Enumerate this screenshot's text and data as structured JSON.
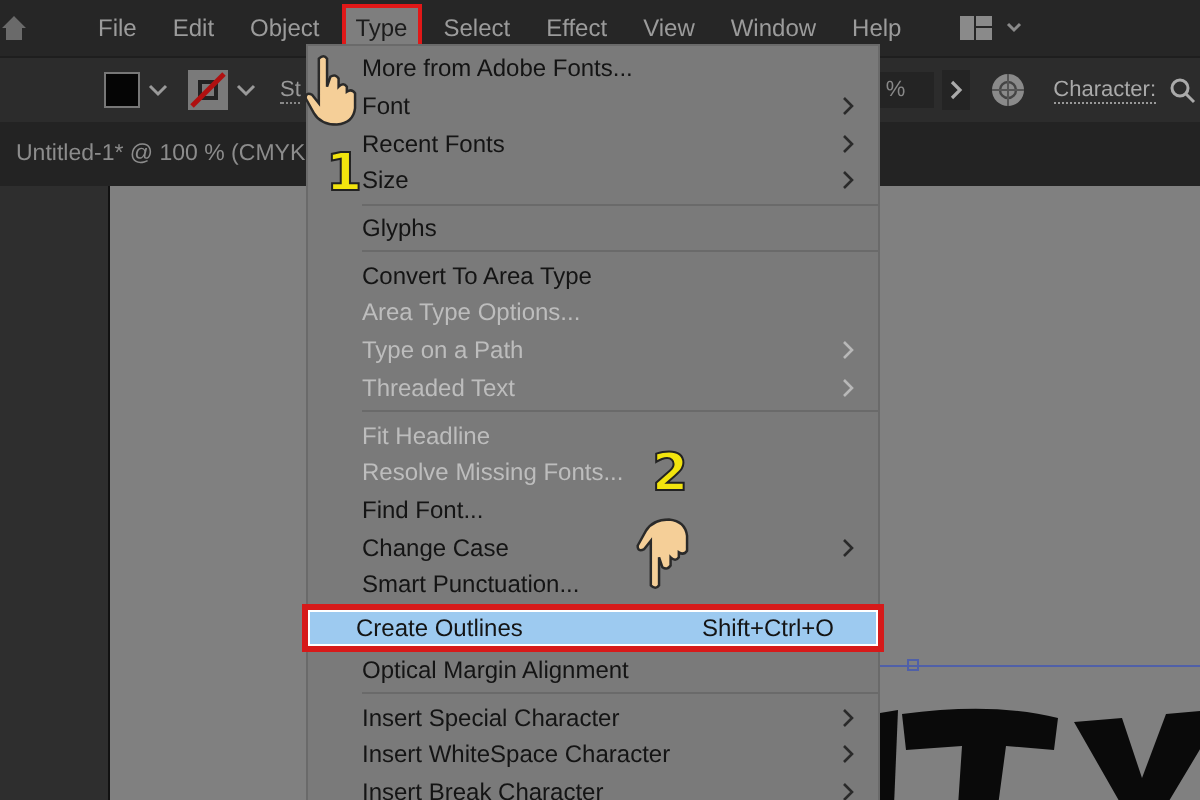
{
  "menubar": {
    "items": [
      {
        "label": "File",
        "selected": false
      },
      {
        "label": "Edit",
        "selected": false
      },
      {
        "label": "Object",
        "selected": false
      },
      {
        "label": "Type",
        "selected": true
      },
      {
        "label": "Select",
        "selected": false
      },
      {
        "label": "Effect",
        "selected": false
      },
      {
        "label": "View",
        "selected": false
      },
      {
        "label": "Window",
        "selected": false
      },
      {
        "label": "Help",
        "selected": false
      }
    ]
  },
  "control_bar": {
    "stroke_label": "St",
    "zoom_fragment": "%",
    "character_label": "Character:"
  },
  "document_tab": {
    "title": "Untitled-1* @ 100 % (CMYK"
  },
  "menu": {
    "items": [
      {
        "kind": "item",
        "label": "More from Adobe Fonts...",
        "disabled": false,
        "selected": false,
        "submenu": false
      },
      {
        "kind": "item",
        "label": "Font",
        "disabled": false,
        "selected": false,
        "submenu": true
      },
      {
        "kind": "item",
        "label": "Recent Fonts",
        "disabled": false,
        "selected": false,
        "submenu": true
      },
      {
        "kind": "item",
        "label": "Size",
        "disabled": false,
        "selected": false,
        "submenu": true
      },
      {
        "kind": "separator"
      },
      {
        "kind": "item",
        "label": "Glyphs",
        "disabled": false,
        "selected": false,
        "submenu": false
      },
      {
        "kind": "separator"
      },
      {
        "kind": "item",
        "label": "Convert To Area Type",
        "disabled": false,
        "selected": false,
        "submenu": false
      },
      {
        "kind": "item",
        "label": "Area Type Options...",
        "disabled": true,
        "selected": false,
        "submenu": false
      },
      {
        "kind": "item",
        "label": "Type on a Path",
        "disabled": true,
        "selected": false,
        "submenu": true
      },
      {
        "kind": "item",
        "label": "Threaded Text",
        "disabled": true,
        "selected": false,
        "submenu": true
      },
      {
        "kind": "separator"
      },
      {
        "kind": "item",
        "label": "Fit Headline",
        "disabled": true,
        "selected": false,
        "submenu": false
      },
      {
        "kind": "item",
        "label": "Resolve Missing Fonts...",
        "disabled": true,
        "selected": false,
        "submenu": false
      },
      {
        "kind": "item",
        "label": "Find Font...",
        "disabled": false,
        "selected": false,
        "submenu": false
      },
      {
        "kind": "item",
        "label": "Change Case",
        "disabled": false,
        "selected": false,
        "submenu": true
      },
      {
        "kind": "item",
        "label": "Smart Punctuation...",
        "disabled": false,
        "selected": false,
        "submenu": false
      },
      {
        "kind": "item",
        "label": "Create Outlines",
        "shortcut": "Shift+Ctrl+O",
        "disabled": false,
        "selected": true,
        "submenu": false
      },
      {
        "kind": "item",
        "label": "Optical Margin Alignment",
        "disabled": false,
        "selected": false,
        "submenu": false
      },
      {
        "kind": "separator"
      },
      {
        "kind": "item",
        "label": "Insert Special Character",
        "disabled": false,
        "selected": false,
        "submenu": true
      },
      {
        "kind": "item",
        "label": "Insert WhiteSpace Character",
        "disabled": false,
        "selected": false,
        "submenu": true
      },
      {
        "kind": "item",
        "label": "Insert Break Character",
        "disabled": false,
        "selected": false,
        "submenu": true
      }
    ]
  },
  "annotations": [
    {
      "label": "1"
    },
    {
      "label": "2"
    }
  ]
}
